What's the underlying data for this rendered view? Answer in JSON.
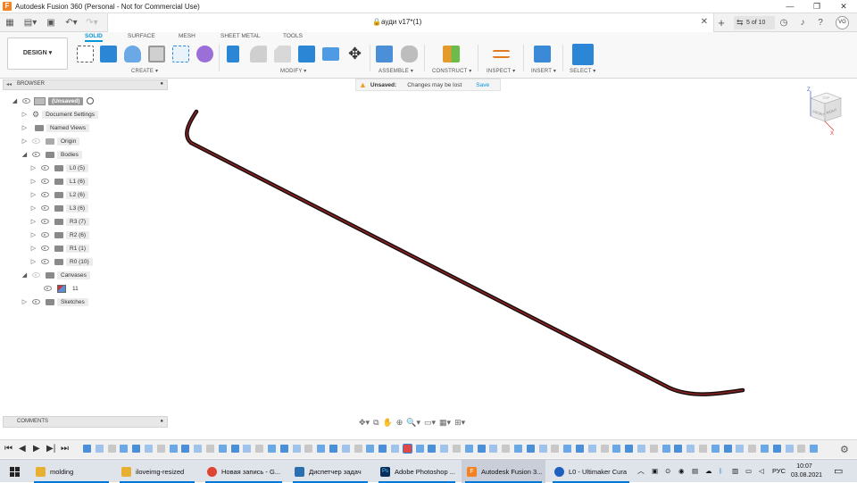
{
  "window": {
    "title": "Autodesk Fusion 360 (Personal - Not for Commercial Use)",
    "app_icon_letter": "F",
    "controls": [
      "—",
      "❐",
      "✕"
    ]
  },
  "tabbar": {
    "doc_title": "ауди v17*(1)",
    "jobs": "5 of 10",
    "user_initials": "VG"
  },
  "ribbon": {
    "workspace": "DESIGN ▾",
    "tabs": [
      "SOLID",
      "SURFACE",
      "MESH",
      "SHEET METAL",
      "TOOLS"
    ],
    "active_tab": "SOLID",
    "groups": {
      "create": "CREATE ▾",
      "modify": "MODIFY ▾",
      "assemble": "ASSEMBLE ▾",
      "construct": "CONSTRUCT ▾",
      "inspect": "INSPECT ▾",
      "insert": "INSERT ▾",
      "select": "SELECT ▾"
    }
  },
  "browser": {
    "title": "BROWSER",
    "root": "(Unsaved)",
    "items": {
      "document_settings": "Document Settings",
      "named_views": "Named Views",
      "origin": "Origin",
      "bodies": "Bodies",
      "l0": "L0 (5)",
      "l1": "L1 (6)",
      "l2": "L2 (6)",
      "l3": "L3 (6)",
      "r3": "R3 (7)",
      "r2": "R2 (6)",
      "r1": "R1 (1)",
      "r0": "R0 (10)",
      "canvases": "Canvases",
      "canvas_11": "11",
      "sketches": "Sketches"
    },
    "comments": "COMMENTS"
  },
  "banner": {
    "label": "Unsaved:",
    "message": "Changes may be lost",
    "action": "Save"
  },
  "viewcube": {
    "faces": [
      "FRONT",
      "RIGHT",
      "TOP"
    ],
    "axes": [
      "Z",
      "X"
    ]
  },
  "taskbar": {
    "items": [
      {
        "label": "molding",
        "icon": "folder-icon",
        "color": "#e8b030"
      },
      {
        "label": "iloveimg-resized",
        "icon": "folder-icon",
        "color": "#e8b030"
      },
      {
        "label": "Новая запись - G...",
        "icon": "chrome-icon",
        "color": "#dd4433"
      },
      {
        "label": "Диспетчер задач",
        "icon": "task-manager-icon",
        "color": "#2a6fb0"
      },
      {
        "label": "Adobe Photoshop ...",
        "icon": "photoshop-icon",
        "color": "#0a2e5c"
      },
      {
        "label": "Autodesk Fusion 3...",
        "icon": "fusion-icon",
        "color": "#f58220"
      },
      {
        "label": "L0 - Ultimaker Cura",
        "icon": "cura-icon",
        "color": "#1f5fbf"
      }
    ],
    "language": "РУС",
    "time": "10:07",
    "date": "03.08.2021"
  }
}
